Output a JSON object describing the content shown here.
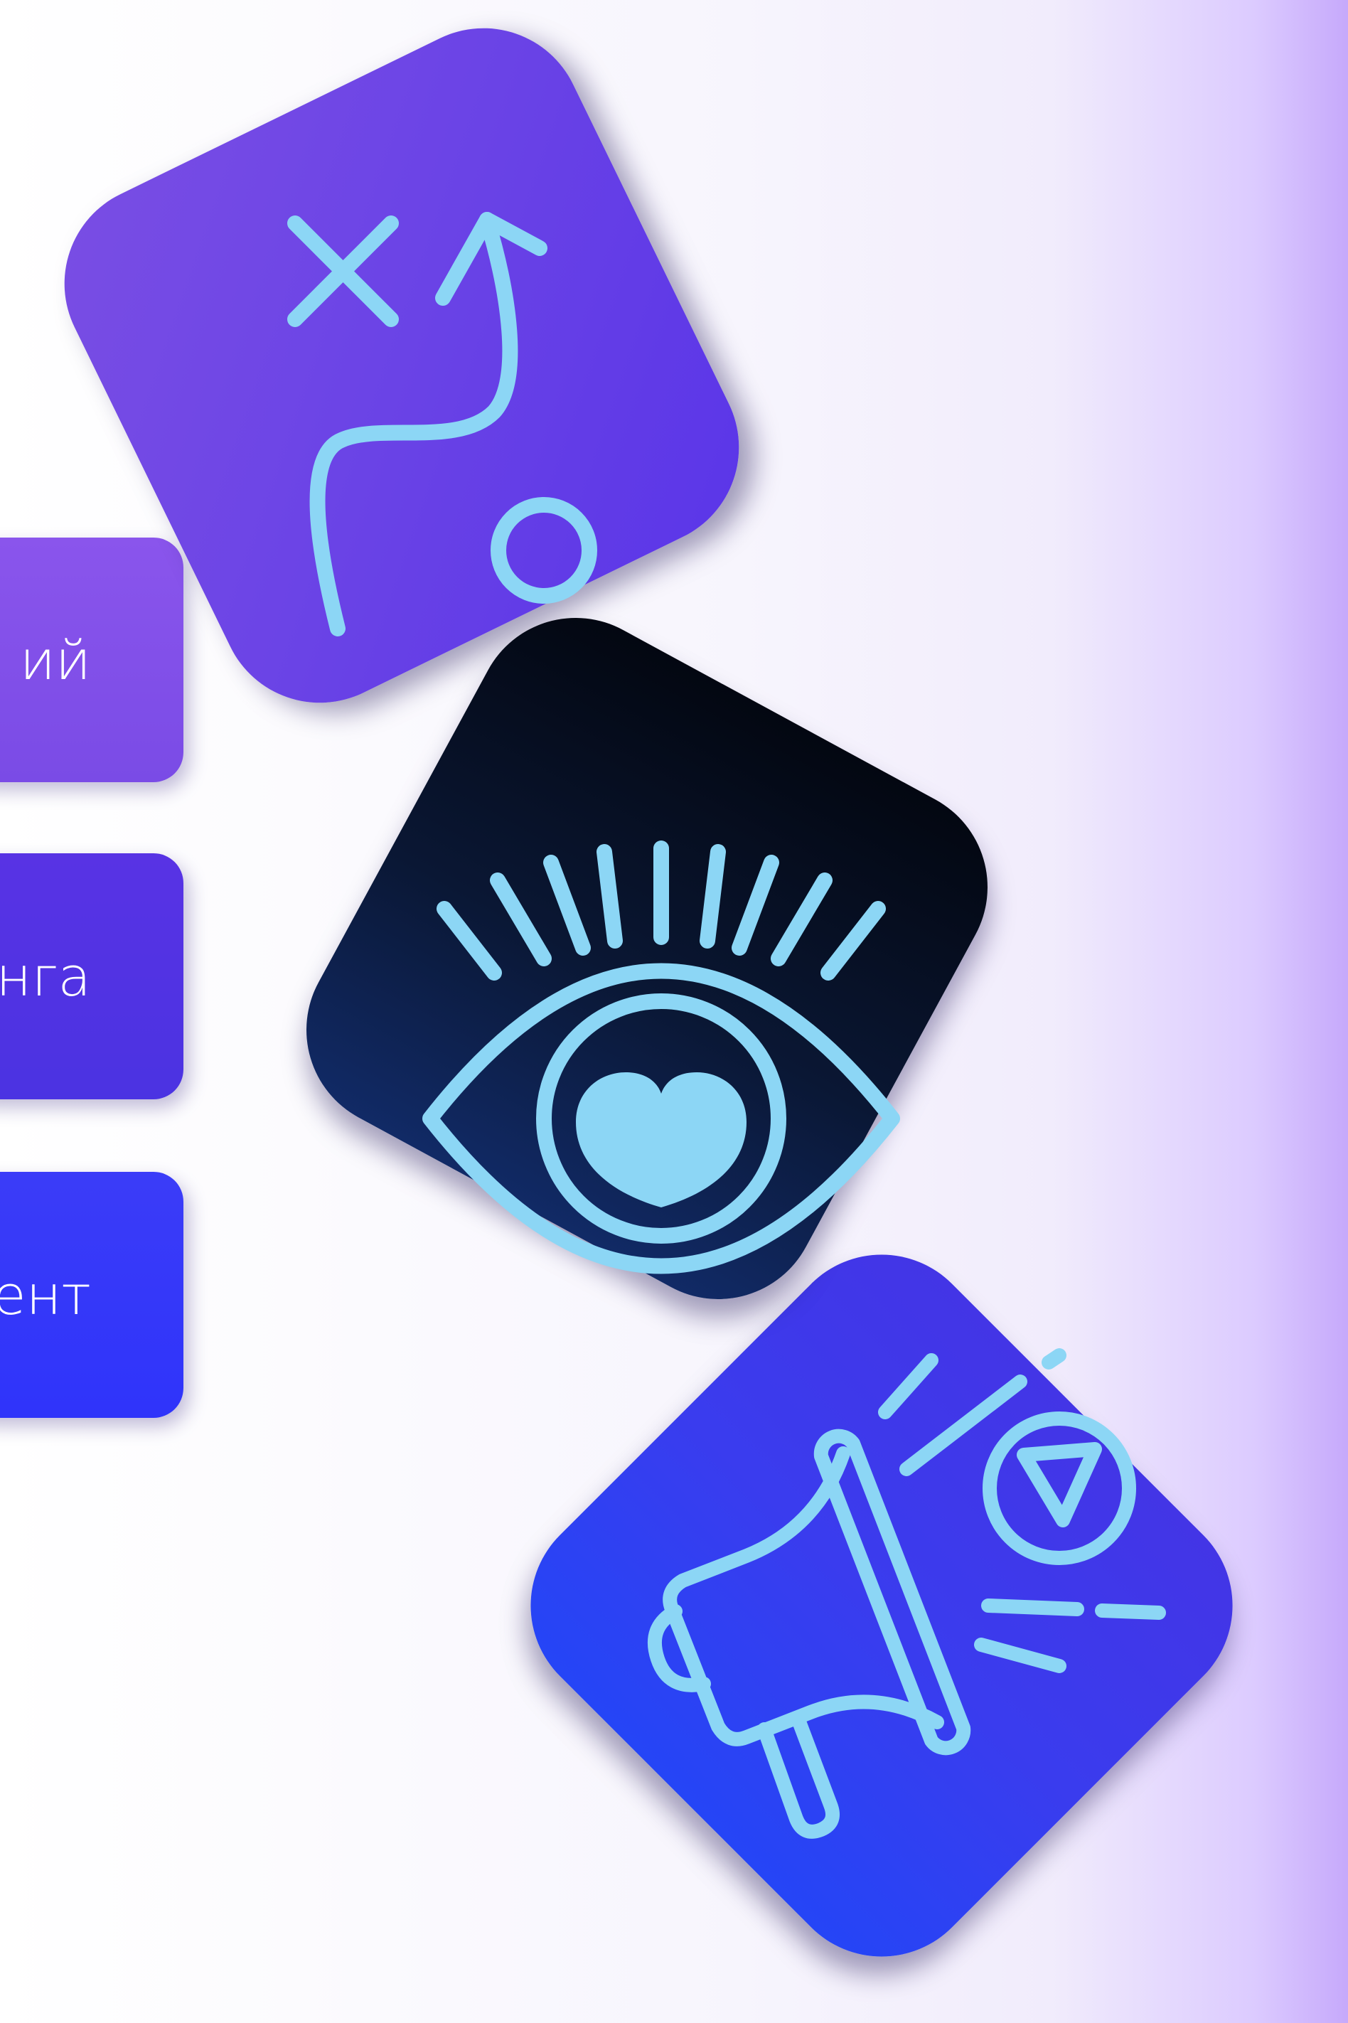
{
  "cards": [
    {
      "id": "strategy",
      "label": "ий",
      "icon": "strategy-play-icon",
      "color": "#7a4ee4"
    },
    {
      "id": "branding",
      "label": "нга",
      "icon": "eye-heart-icon",
      "color": "#0a1734"
    },
    {
      "id": "management",
      "label": "ент",
      "icon": "megaphone-icon",
      "color": "#2f34fa"
    }
  ],
  "icon_color": "#8cd6f5",
  "background_accent": "#c6a9fb"
}
